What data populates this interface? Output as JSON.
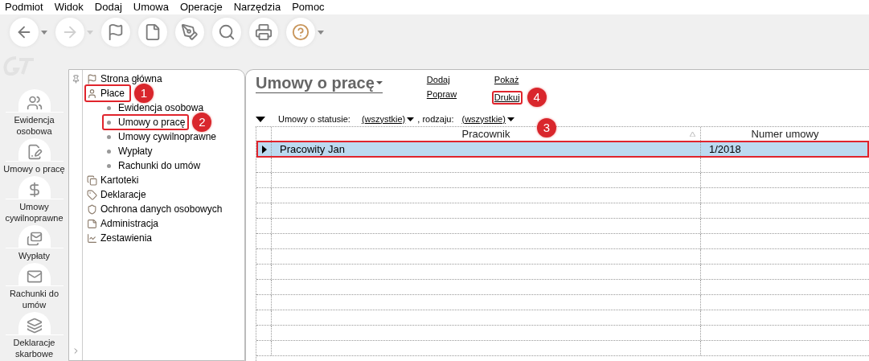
{
  "menu": [
    "Podmiot",
    "Widok",
    "Dodaj",
    "Umowa",
    "Operacje",
    "Narzędzia",
    "Pomoc"
  ],
  "toolbar": [
    {
      "kind": "back",
      "dropdown": true,
      "disabled": false
    },
    {
      "kind": "forward",
      "dropdown": true,
      "disabled": true
    },
    {
      "kind": "flag",
      "dropdown": false,
      "disabled": false
    },
    {
      "kind": "page",
      "dropdown": false,
      "disabled": false
    },
    {
      "kind": "edit",
      "dropdown": false,
      "disabled": false
    },
    {
      "kind": "search",
      "dropdown": false,
      "disabled": false
    },
    {
      "kind": "print",
      "dropdown": false,
      "disabled": false
    },
    {
      "kind": "help",
      "dropdown": true,
      "disabled": false
    }
  ],
  "shortcuts": [
    {
      "kind": "people",
      "label": "Ewidencja osobowa"
    },
    {
      "kind": "contract",
      "label": "Umowy o pracę"
    },
    {
      "kind": "money",
      "label": "Umowy cywilnoprawne"
    },
    {
      "kind": "envelopes",
      "label": "Wypłaty"
    },
    {
      "kind": "mail",
      "label": "Rachunki do umów"
    },
    {
      "kind": "stack",
      "label": "Deklaracje skarbowe"
    }
  ],
  "tree": [
    {
      "kind": "flag",
      "label": "Strona główna",
      "highlighted": false
    },
    {
      "kind": "person",
      "label": "Płace",
      "highlighted": true,
      "callout": "1",
      "children": [
        {
          "label": "Ewidencja osobowa",
          "highlighted": false
        },
        {
          "label": "Umowy o pracę",
          "highlighted": true,
          "callout": "2"
        },
        {
          "label": "Umowy cywilnoprawne",
          "highlighted": false
        },
        {
          "label": "Wypłaty",
          "highlighted": false
        },
        {
          "label": "Rachunki do umów",
          "highlighted": false
        }
      ]
    },
    {
      "kind": "cards",
      "label": "Kartoteki",
      "highlighted": false
    },
    {
      "kind": "tag",
      "label": "Deklaracje",
      "highlighted": false
    },
    {
      "kind": "shield",
      "label": "Ochrona danych osobowych",
      "highlighted": false
    },
    {
      "kind": "note",
      "label": "Administracja",
      "highlighted": false
    },
    {
      "kind": "chart",
      "label": "Zestawienia",
      "highlighted": false
    }
  ],
  "view": {
    "title": "Umowy o pracę",
    "actions": [
      [
        {
          "label": "Dodaj",
          "highlighted": false
        },
        {
          "label": "Popraw",
          "highlighted": false
        }
      ],
      [
        {
          "label": "Pokaż",
          "highlighted": false
        },
        {
          "label": "Drukuj",
          "highlighted": true,
          "callout": "4"
        }
      ]
    ],
    "filter": {
      "status_label": "Umowy o statusie:",
      "status_value": "(wszystkie)",
      "kind_label": ", rodzaju:",
      "kind_value": "(wszystkie)"
    },
    "table": {
      "columns": [
        {
          "label": "Pracownik",
          "sorted": true
        },
        {
          "label": "Numer umowy",
          "sorted": false
        }
      ],
      "header_callout": "3",
      "rows": [
        {
          "cells": [
            "Pracowity Jan",
            "1/2018"
          ],
          "selected": true,
          "highlighted": true
        }
      ]
    }
  }
}
